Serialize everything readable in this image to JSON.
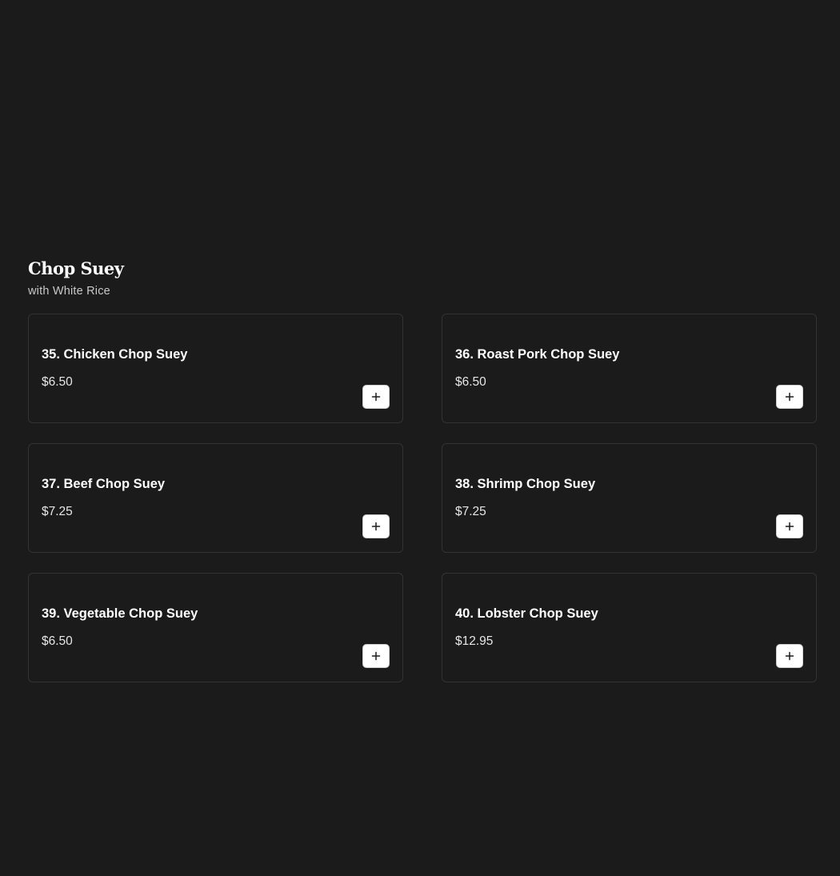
{
  "section": {
    "title": "Chop Suey",
    "subtitle": "with White Rice"
  },
  "items": [
    {
      "name": "35. Chicken Chop Suey",
      "price": "$6.50"
    },
    {
      "name": "36. Roast Pork Chop Suey",
      "price": "$6.50"
    },
    {
      "name": "37. Beef Chop Suey",
      "price": "$7.25"
    },
    {
      "name": "38. Shrimp Chop Suey",
      "price": "$7.25"
    },
    {
      "name": "39. Vegetable Chop Suey",
      "price": "$6.50"
    },
    {
      "name": "40. Lobster Chop Suey",
      "price": "$12.95"
    }
  ],
  "icons": {
    "add": "plus-icon"
  },
  "colors": {
    "background": "#1b1b1b",
    "card_border": "#333333",
    "text": "#ffffff",
    "button_bg": "#ffffff"
  }
}
